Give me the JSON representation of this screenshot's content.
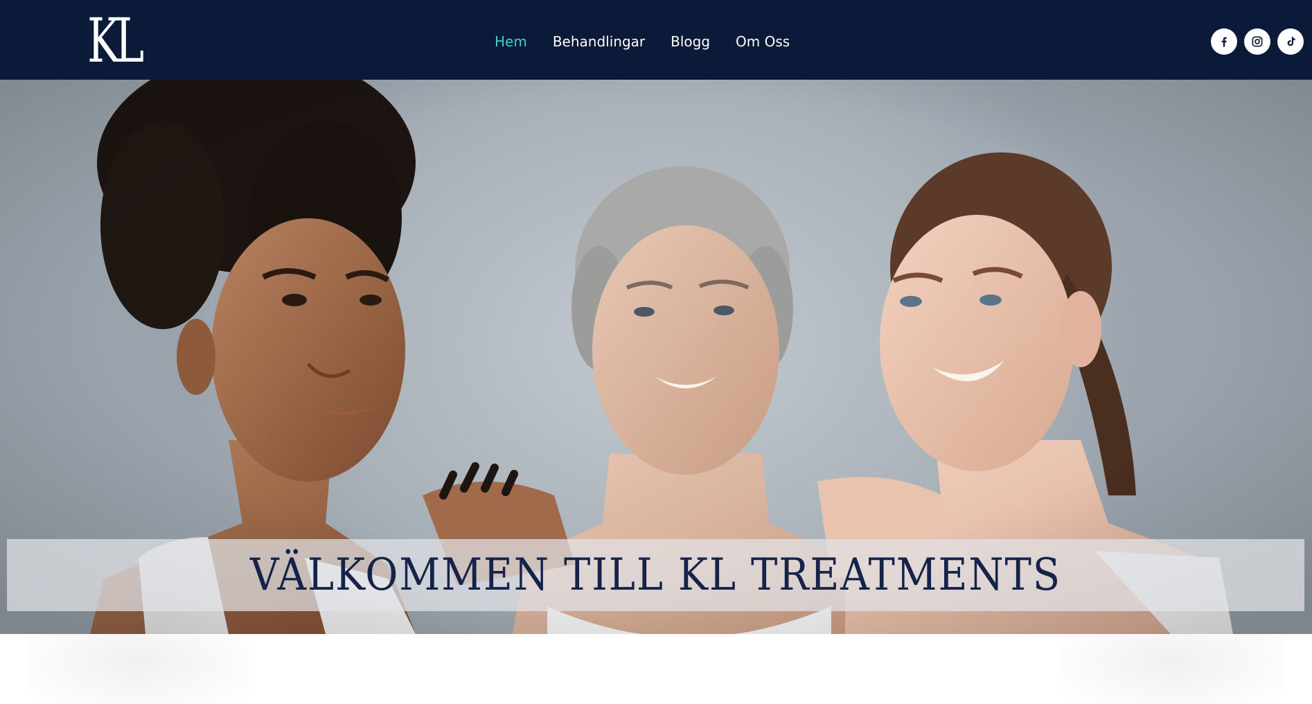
{
  "header": {
    "logo_text": "KL",
    "nav": [
      {
        "label": "Hem",
        "active": true
      },
      {
        "label": "Behandlingar",
        "active": false
      },
      {
        "label": "Blogg",
        "active": false
      },
      {
        "label": "Om Oss",
        "active": false
      }
    ],
    "social": [
      {
        "icon": "facebook-icon"
      },
      {
        "icon": "instagram-icon"
      },
      {
        "icon": "tiktok-icon"
      }
    ]
  },
  "hero": {
    "title": "VÄLKOMMEN TILL KL TREATMENTS",
    "image_subject": "three-women-smiling-photo"
  },
  "colors": {
    "header_bg": "#0b1a38",
    "nav_active": "#3fd0c6",
    "nav_text": "#ffffff",
    "title_text": "#15224a"
  }
}
